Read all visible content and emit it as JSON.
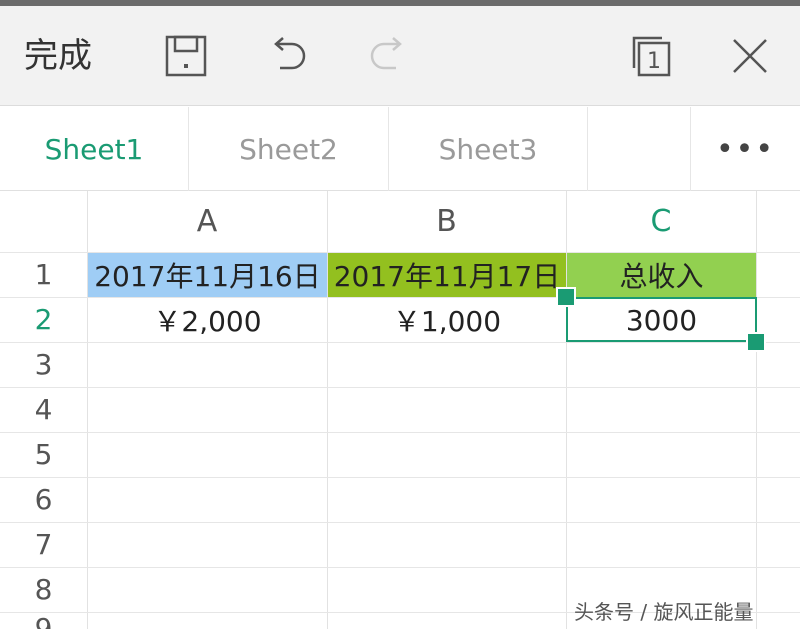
{
  "toolbar": {
    "done_label": "完成",
    "icons": [
      "save-icon",
      "undo-icon",
      "redo-icon",
      "sheets-count-icon",
      "close-icon"
    ],
    "sheet_count_badge": "1"
  },
  "tabs": [
    {
      "label": "Sheet1",
      "active": true
    },
    {
      "label": "Sheet2",
      "active": false
    },
    {
      "label": "Sheet3",
      "active": false
    }
  ],
  "more_label": "•••",
  "columns": [
    {
      "label": "A",
      "active": false
    },
    {
      "label": "B",
      "active": false
    },
    {
      "label": "C",
      "active": true
    }
  ],
  "rows": [
    "1",
    "2",
    "3",
    "4",
    "5",
    "6",
    "7",
    "8",
    "9"
  ],
  "active_row": "2",
  "cells": {
    "A1": "2017年11月16日",
    "B1": "2017年11月17日",
    "C1": "总收入",
    "A2": "￥2,000",
    "B2": "￥1,000",
    "C2": "3000"
  },
  "colors": {
    "accent": "#1a9b73",
    "a1_fill": "#9fcdf5",
    "b1_fill": "#93c01f",
    "c1_fill": "#92d050"
  },
  "watermark": "头条号 / 旋风正能量"
}
